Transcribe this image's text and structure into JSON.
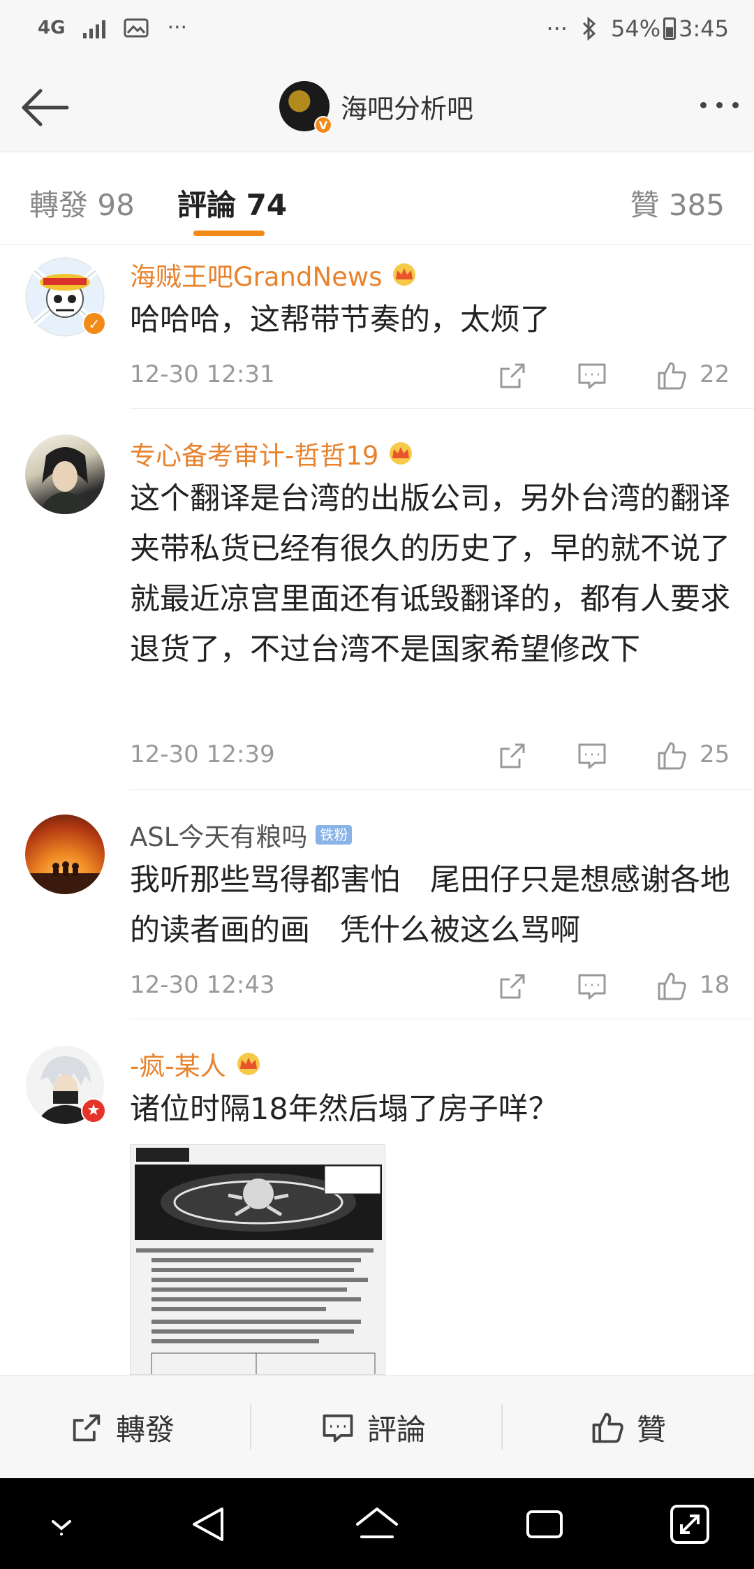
{
  "status_bar": {
    "network": "4G",
    "battery": "54%",
    "time": "3:45"
  },
  "header": {
    "title": "海吧分析吧",
    "verified_mark": "V"
  },
  "tabs": [
    {
      "label": "轉發 98"
    },
    {
      "label": "評論 74"
    },
    {
      "label": "贊 385"
    }
  ],
  "comments": [
    {
      "user": "海贼王吧GrandNews",
      "text": "哈哈哈，这帮带节奏的，太烦了",
      "time": "12-30 12:31",
      "likes": "22"
    },
    {
      "user": "专心备考审计-哲哲19",
      "text": "这个翻译是台湾的出版公司，另外台湾的翻译夹带私货已经有很久的历史了，早的就不说了就最近凉宫里面还有诋毁翻译的，都有人要求退货了，不过台湾不是国家希望修改下",
      "time": "12-30 12:39",
      "likes": "25"
    },
    {
      "user": "ASL今天有粮吗",
      "badge": "铁粉",
      "text": "我听那些骂得都害怕　尾田仔只是想感谢各地的读者画的画　凭什么被这么骂啊",
      "time": "12-30 12:43",
      "likes": "18"
    },
    {
      "user": "-疯-某人",
      "text": "诸位时隔18年然后塌了房子咩？"
    }
  ],
  "bottom_bar": {
    "repost": "轉發",
    "comment": "評論",
    "like": "贊"
  },
  "colors": {
    "accent": "#f28a1a",
    "username": "#e8822c",
    "meta": "#999999"
  }
}
